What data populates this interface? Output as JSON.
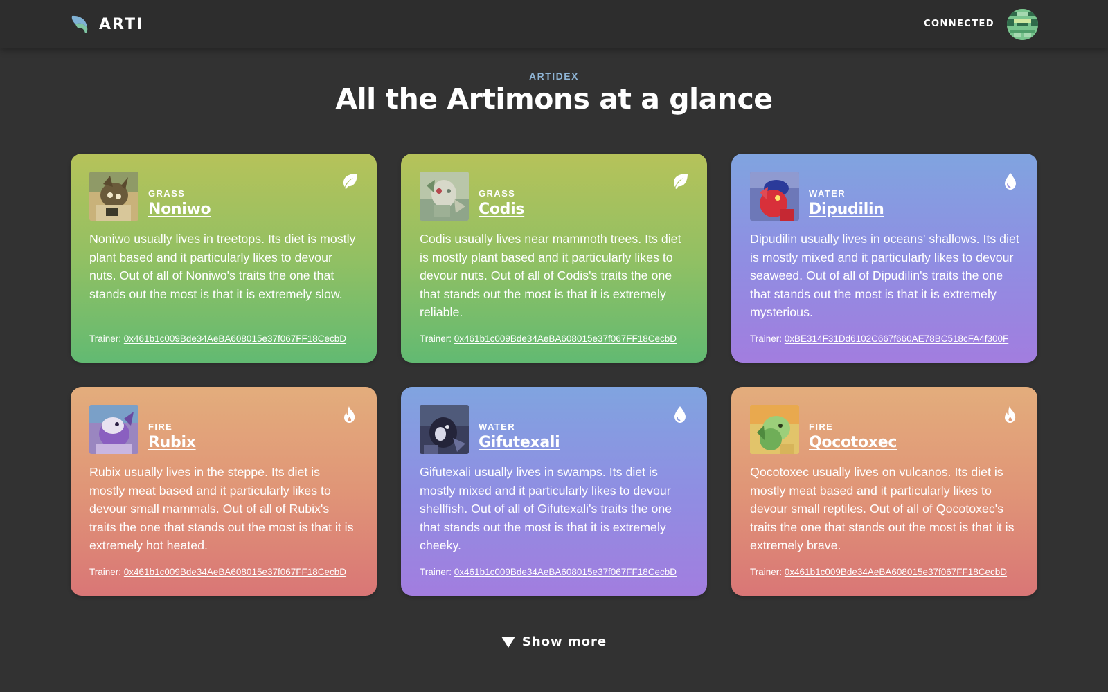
{
  "header": {
    "logo_text": "ARTI",
    "logo_icon": "arti-leaf-logo",
    "status": "CONNECTED",
    "avatar_icon": "pixel-avatar"
  },
  "hero": {
    "eyebrow": "ARTIDEX",
    "title": "All the Artimons at a glance"
  },
  "cards": [
    {
      "type": "GRASS",
      "type_icon": "leaf-icon",
      "name": "Noniwo",
      "description": "Noniwo usually lives in treetops. Its diet is mostly plant based and it particularly likes to devour nuts. Out of all of Noniwo's traits the one that stands out the most is that it is extremely slow.",
      "trainer_label": "Trainer:",
      "trainer": "0x461b1c009Bde34AeBA608015e37f067FF18CecbD"
    },
    {
      "type": "GRASS",
      "type_icon": "leaf-icon",
      "name": "Codis",
      "description": "Codis usually lives near mammoth trees. Its diet is mostly plant based and it particularly likes to devour nuts. Out of all of Codis's traits the one that stands out the most is that it is extremely reliable.",
      "trainer_label": "Trainer:",
      "trainer": "0x461b1c009Bde34AeBA608015e37f067FF18CecbD"
    },
    {
      "type": "WATER",
      "type_icon": "water-drop-icon",
      "name": "Dipudilin",
      "description": "Dipudilin usually lives in oceans' shallows. Its diet is mostly mixed and it particularly likes to devour seaweed. Out of all of Dipudilin's traits the one that stands out the most is that it is extremely mysterious.",
      "trainer_label": "Trainer:",
      "trainer": "0xBE314F31Dd6102C667f660AE78BC518cFA4f300F"
    },
    {
      "type": "FIRE",
      "type_icon": "flame-icon",
      "name": "Rubix",
      "description": "Rubix usually lives in the steppe. Its diet is mostly meat based and it particularly likes to devour small mammals. Out of all of Rubix's traits the one that stands out the most is that it is extremely hot heated.",
      "trainer_label": "Trainer:",
      "trainer": "0x461b1c009Bde34AeBA608015e37f067FF18CecbD"
    },
    {
      "type": "WATER",
      "type_icon": "water-drop-icon",
      "name": "Gifutexali",
      "description": "Gifutexali usually lives in swamps. Its diet is mostly mixed and it particularly likes to devour shellfish. Out of all of Gifutexali's traits the one that stands out the most is that it is extremely cheeky.",
      "trainer_label": "Trainer:",
      "trainer": "0x461b1c009Bde34AeBA608015e37f067FF18CecbD"
    },
    {
      "type": "FIRE",
      "type_icon": "flame-icon",
      "name": "Qocotoxec",
      "description": "Qocotoxec usually lives on vulcanos. Its diet is mostly meat based and it particularly likes to devour small reptiles. Out of all of Qocotoxec's traits the one that stands out the most is that it is extremely brave.",
      "trainer_label": "Trainer:",
      "trainer": "0x461b1c009Bde34AeBA608015e37f067FF18CecbD"
    }
  ],
  "footer": {
    "show_more": "Show more",
    "show_more_icon": "triangle-down-icon"
  },
  "colors": {
    "background": "#323232",
    "header_bg": "#2d2d2d",
    "grass_gradient": [
      "#b6c25a",
      "#62ba72"
    ],
    "water_gradient": [
      "#80a4e0",
      "#a27ddf"
    ],
    "fire_gradient": [
      "#e3ad7c",
      "#d97676"
    ],
    "eyebrow": "#8fb5d6"
  }
}
